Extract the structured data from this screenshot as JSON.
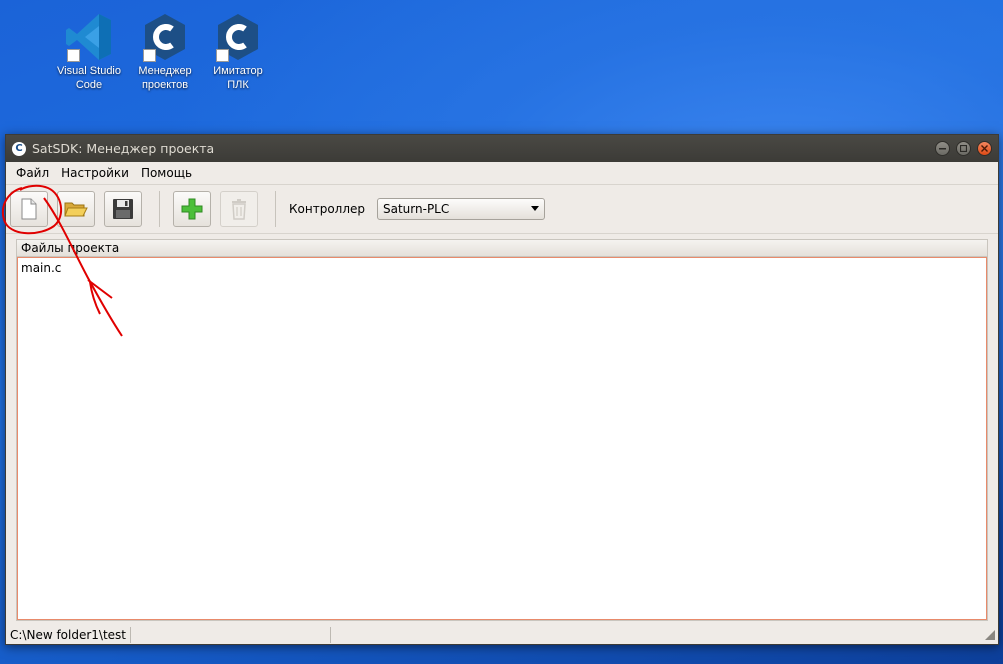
{
  "desktop": {
    "icons": [
      {
        "label_line1": "Visual Studio",
        "label_line2": "Code",
        "icon": "vscode-icon"
      },
      {
        "label_line1": "Менеджер",
        "label_line2": "проектов",
        "icon": "satsdk-c-icon"
      },
      {
        "label_line1": "Имитатор",
        "label_line2": "ПЛК",
        "icon": "satsdk-c-icon"
      }
    ]
  },
  "window": {
    "title": "SatSDK: Менеджер проекта",
    "logo_letter": "C"
  },
  "menu": {
    "file": "Файл",
    "settings": "Настройки",
    "help": "Помощь"
  },
  "toolbar": {
    "controller_label": "Контроллер",
    "controller_value": "Saturn-PLC"
  },
  "panel": {
    "header": "Файлы проекта",
    "files": [
      "main.c"
    ]
  },
  "statusbar": {
    "path": "C:\\New folder1\\test"
  },
  "colors": {
    "annotation": "#e00000",
    "accent_blue": "#1f6fe0",
    "titlebar": "#3c3b37"
  }
}
